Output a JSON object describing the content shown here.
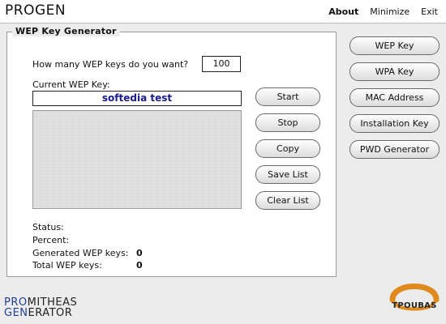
{
  "app": {
    "title": "PROGEN"
  },
  "menu": {
    "about": "About",
    "minimize": "Minimize",
    "exit": "Exit"
  },
  "generator": {
    "title": "WEP Key Generator",
    "count_prompt": "How many WEP keys do you want?",
    "count_value": "100",
    "current_label": "Current WEP Key:",
    "current_value": "softedia test",
    "status_label": "Status:",
    "percent_label": "Percent:",
    "generated_label": "Generated WEP keys:",
    "generated_value": "0",
    "total_label": "Total WEP keys:",
    "total_value": "0"
  },
  "actions": {
    "start": "Start",
    "stop": "Stop",
    "copy": "Copy",
    "save_list": "Save List",
    "clear_list": "Clear List"
  },
  "sidebar": [
    {
      "label": "WEP Key"
    },
    {
      "label": "WPA Key"
    },
    {
      "label": "MAC Address"
    },
    {
      "label": "Installation Key"
    },
    {
      "label": "PWD Generator"
    }
  ],
  "footer": {
    "logo_line1_accent": "PRO",
    "logo_line1_rest": "MITHEAS",
    "logo_line2_accent": "GEN",
    "logo_line2_rest": "ERATOR",
    "brand": "TPOUBAS"
  },
  "colors": {
    "key_text": "#1a1a8c",
    "logo_accent": "#1f3f8f",
    "brand_ring": "#e08a1e"
  }
}
